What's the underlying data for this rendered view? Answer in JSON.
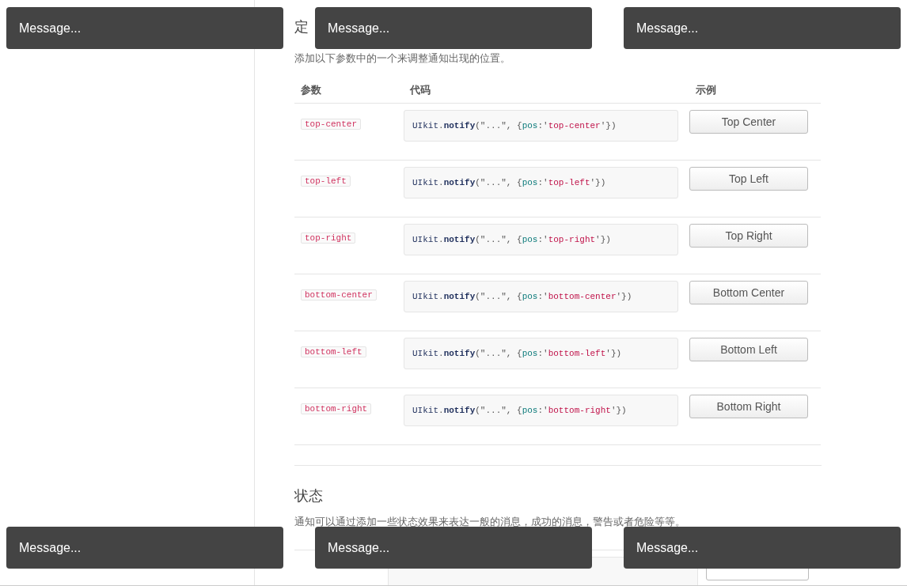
{
  "section1": {
    "heading": "定",
    "description": "添加以下参数中的一个来调整通知出现的位置。",
    "columns": [
      "参数",
      "代码",
      "示例"
    ],
    "rows": [
      {
        "param": "top-center",
        "code": [
          {
            "kind": "object",
            "text": "UIkit"
          },
          {
            "kind": "plain",
            "text": "."
          },
          {
            "kind": "method",
            "text": "notify"
          },
          {
            "kind": "plain",
            "text": "(\"...\", {"
          },
          {
            "kind": "key",
            "text": "pos"
          },
          {
            "kind": "plain",
            "text": ":'"
          },
          {
            "kind": "string",
            "text": "top-center"
          },
          {
            "kind": "plain",
            "text": "'})"
          }
        ],
        "button": "Top Center"
      },
      {
        "param": "top-left",
        "code": [
          {
            "kind": "object",
            "text": "UIkit"
          },
          {
            "kind": "plain",
            "text": "."
          },
          {
            "kind": "method",
            "text": "notify"
          },
          {
            "kind": "plain",
            "text": "(\"...\", {"
          },
          {
            "kind": "key",
            "text": "pos"
          },
          {
            "kind": "plain",
            "text": ":'"
          },
          {
            "kind": "string",
            "text": "top-left"
          },
          {
            "kind": "plain",
            "text": "'})"
          }
        ],
        "button": "Top Left"
      },
      {
        "param": "top-right",
        "code": [
          {
            "kind": "object",
            "text": "UIkit"
          },
          {
            "kind": "plain",
            "text": "."
          },
          {
            "kind": "method",
            "text": "notify"
          },
          {
            "kind": "plain",
            "text": "(\"...\", {"
          },
          {
            "kind": "key",
            "text": "pos"
          },
          {
            "kind": "plain",
            "text": ":'"
          },
          {
            "kind": "string",
            "text": "top-right"
          },
          {
            "kind": "plain",
            "text": "'})"
          }
        ],
        "button": "Top Right"
      },
      {
        "param": "bottom-center",
        "code": [
          {
            "kind": "object",
            "text": "UIkit"
          },
          {
            "kind": "plain",
            "text": "."
          },
          {
            "kind": "method",
            "text": "notify"
          },
          {
            "kind": "plain",
            "text": "(\"...\", {"
          },
          {
            "kind": "key",
            "text": "pos"
          },
          {
            "kind": "plain",
            "text": ":'"
          },
          {
            "kind": "string",
            "text": "bottom-center"
          },
          {
            "kind": "plain",
            "text": "'})"
          }
        ],
        "button": "Bottom Center"
      },
      {
        "param": "bottom-left",
        "code": [
          {
            "kind": "object",
            "text": "UIkit"
          },
          {
            "kind": "plain",
            "text": "."
          },
          {
            "kind": "method",
            "text": "notify"
          },
          {
            "kind": "plain",
            "text": "(\"...\", {"
          },
          {
            "kind": "key",
            "text": "pos"
          },
          {
            "kind": "plain",
            "text": ":'"
          },
          {
            "kind": "string",
            "text": "bottom-left"
          },
          {
            "kind": "plain",
            "text": "'})"
          }
        ],
        "button": "Bottom Left"
      },
      {
        "param": "bottom-right",
        "code": [
          {
            "kind": "object",
            "text": "UIkit"
          },
          {
            "kind": "plain",
            "text": "."
          },
          {
            "kind": "method",
            "text": "notify"
          },
          {
            "kind": "plain",
            "text": "(\"...\", {"
          },
          {
            "kind": "key",
            "text": "pos"
          },
          {
            "kind": "plain",
            "text": ":'"
          },
          {
            "kind": "string",
            "text": "bottom-right"
          },
          {
            "kind": "plain",
            "text": "'})"
          }
        ],
        "button": "Bottom Right"
      }
    ]
  },
  "section2": {
    "heading": "状态",
    "description": "通知可以通过添加一些状态效果来表达一般的消息，成功的消息，警告或者危险等等。"
  },
  "notifications": {
    "top": [
      {
        "text": "Message..."
      },
      {
        "text": "Message..."
      },
      {
        "text": "Message..."
      }
    ],
    "bottom": [
      {
        "text": "Message..."
      },
      {
        "text": "Message..."
      },
      {
        "text": "Message..."
      }
    ]
  }
}
